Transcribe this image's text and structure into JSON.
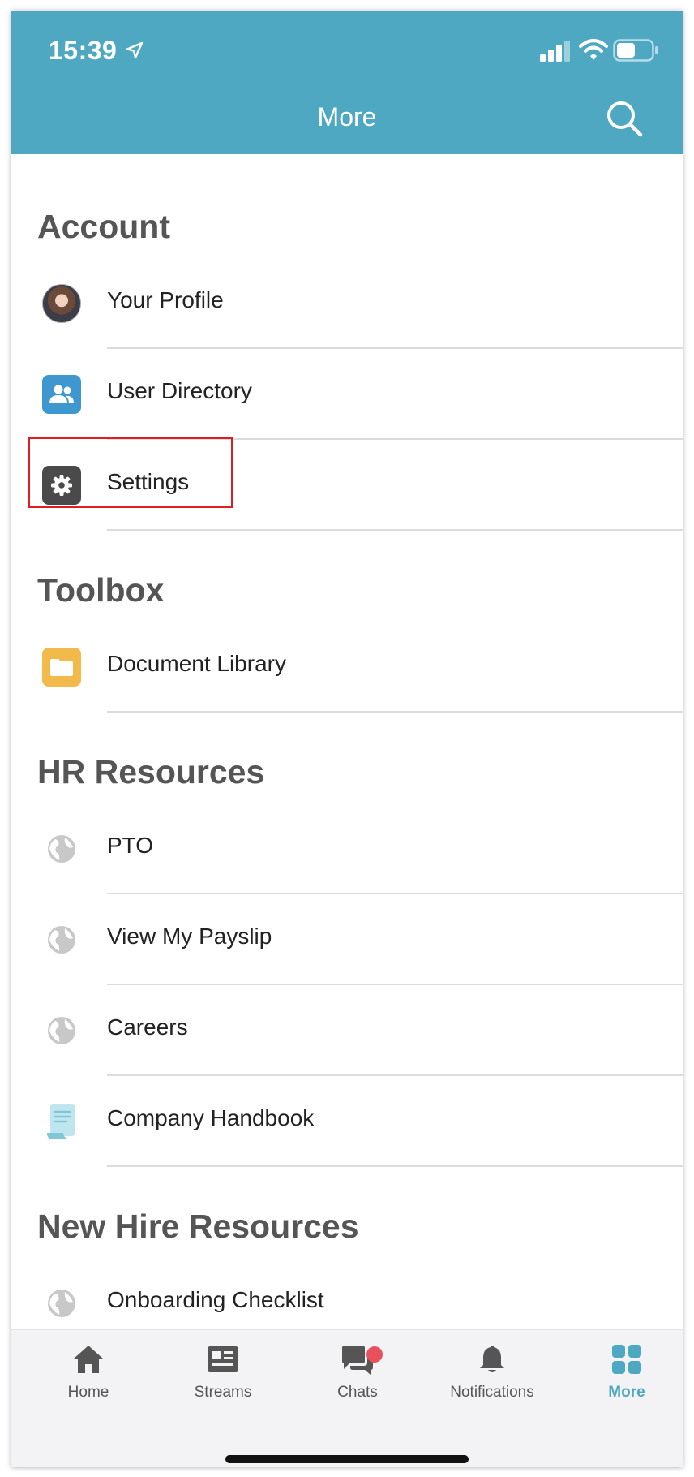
{
  "status_bar": {
    "time": "15:39"
  },
  "header": {
    "title": "More"
  },
  "sections": [
    {
      "title": "Account",
      "items": [
        {
          "label": "Your Profile",
          "icon": "avatar"
        },
        {
          "label": "User Directory",
          "icon": "users-icon"
        },
        {
          "label": "Settings",
          "icon": "gear-icon"
        }
      ]
    },
    {
      "title": "Toolbox",
      "items": [
        {
          "label": "Document Library",
          "icon": "folder-icon"
        }
      ]
    },
    {
      "title": "HR Resources",
      "items": [
        {
          "label": "PTO",
          "icon": "globe-icon"
        },
        {
          "label": "View My Payslip",
          "icon": "globe-icon"
        },
        {
          "label": "Careers",
          "icon": "globe-icon"
        },
        {
          "label": "Company Handbook",
          "icon": "scroll-icon"
        }
      ]
    },
    {
      "title": "New Hire Resources",
      "items": [
        {
          "label": "Onboarding Checklist",
          "icon": "globe-icon"
        }
      ]
    }
  ],
  "tabbar": {
    "tabs": [
      {
        "label": "Home",
        "icon": "home-icon"
      },
      {
        "label": "Streams",
        "icon": "streams-icon"
      },
      {
        "label": "Chats",
        "icon": "chats-icon"
      },
      {
        "label": "Notifications",
        "icon": "bell-icon"
      },
      {
        "label": "More",
        "icon": "grid-icon"
      }
    ],
    "active": "More"
  },
  "colors": {
    "header": "#4ea8c2",
    "accent": "#4ea8c2",
    "highlight": "#e31b23",
    "badge": "#e8515b",
    "users_tile": "#3f97cf",
    "settings_tile": "#4a4a4a",
    "folder_tile": "#f2b94b"
  }
}
